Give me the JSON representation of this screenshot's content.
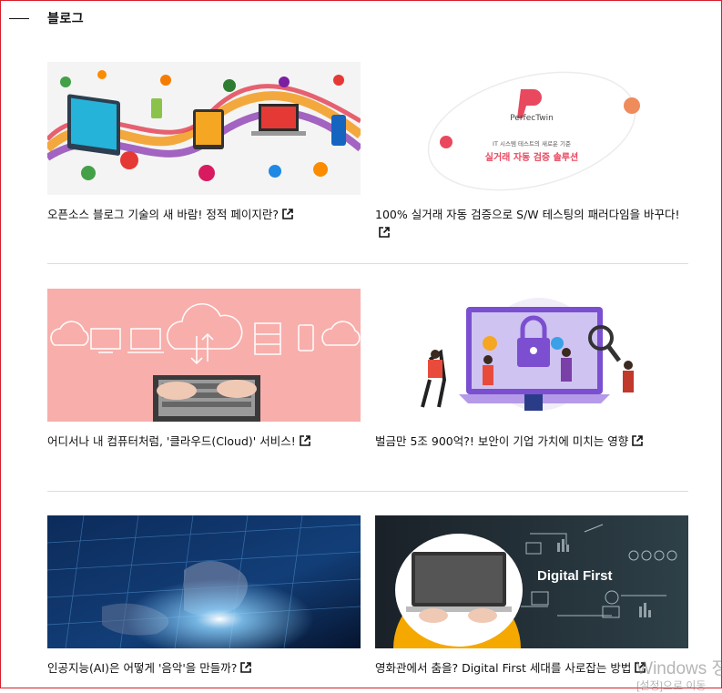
{
  "section": {
    "title": "블로그"
  },
  "posts": [
    {
      "title": "오픈소스 블로그 기술의 새 바람! 정적 페이지란?",
      "link_icon": "external-link-icon"
    },
    {
      "title": "100% 실거래 자동 검증으로 S/W 테스팅의 패러다임을 바꾸다!",
      "link_icon": "external-link-icon",
      "image_text": {
        "brand": "PerfecTwin",
        "tagline": "IT 시스템 테스트의 새로운 기준",
        "headline": "실거래 자동 검증 솔루션"
      }
    },
    {
      "title": "어디서나 내 컴퓨터처럼, '클라우드(Cloud)' 서비스!",
      "link_icon": "external-link-icon"
    },
    {
      "title": "벌금만 5조 900억?! 보안이 기업 가치에 미치는 영향",
      "link_icon": "external-link-icon"
    },
    {
      "title": "인공지능(AI)은 어떻게 '음악'을 만들까?",
      "link_icon": "external-link-icon"
    },
    {
      "title": "영화관에서 춤을? Digital First 세대를 사로잡는 방법",
      "link_icon": "external-link-icon",
      "image_text": {
        "headline": "Digital First"
      }
    }
  ],
  "os_watermark": {
    "line1": "Windows 정",
    "line2": "[설정]으로 이동"
  },
  "colors": {
    "frame": "#d61f2b",
    "perfectwin": "#e8495f"
  }
}
